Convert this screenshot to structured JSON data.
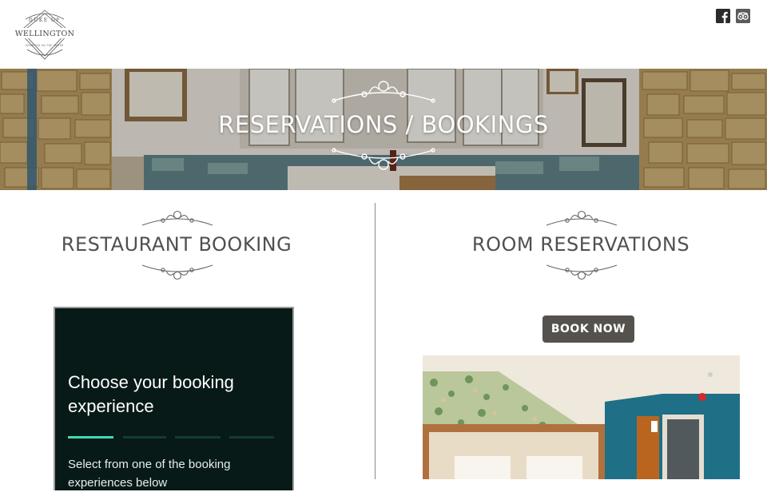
{
  "header": {
    "logo": {
      "top_text": "DUKE OF",
      "main_text": "WELLINGTON",
      "tagline": "BOURTON ON THE WATER"
    },
    "social": [
      {
        "name": "facebook-icon",
        "glyph": "f"
      },
      {
        "name": "tripadvisor-icon",
        "glyph": "oo"
      }
    ]
  },
  "hero": {
    "title": "RESERVATIONS / BOOKINGS"
  },
  "restaurant": {
    "title": "RESTAURANT BOOKING",
    "widget": {
      "heading": "Choose your booking experience",
      "steps_total": 4,
      "current_step": 1,
      "text": "Select from one of the booking experiences below"
    }
  },
  "rooms": {
    "title": "ROOM RESERVATIONS",
    "book_now_label": "BOOK NOW"
  },
  "colors": {
    "widget_bg": "#071a17",
    "progress_active": "#3fd9b5",
    "progress_inactive": "#163a33",
    "button_bg": "#55524d",
    "title_text": "#505050",
    "room_wall": "#1f6f86"
  }
}
